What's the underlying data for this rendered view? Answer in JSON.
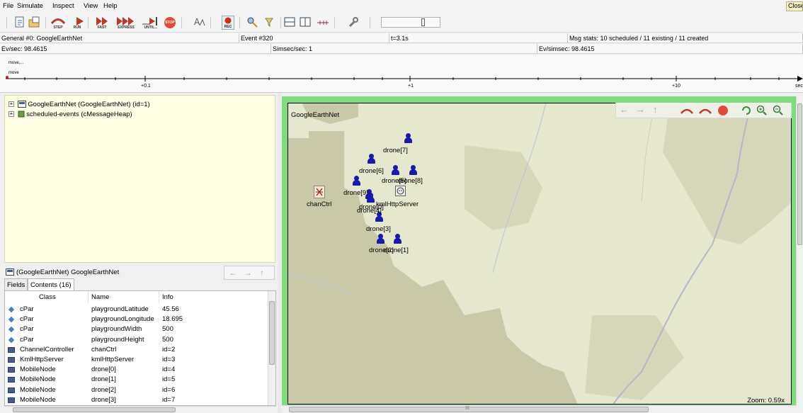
{
  "menu": {
    "items": [
      "File",
      "Simulate",
      "Inspect",
      "View",
      "Help"
    ],
    "close_label": "Close"
  },
  "toolbar": {
    "step_label": "STEP",
    "run_label": "RUN",
    "fast_label": "FAST",
    "express_label": "EXPRESS",
    "until_label": "UNTIL...",
    "stop_label": "STOP",
    "rec_label": "REC"
  },
  "status": {
    "network": "General #0: GoogleEarthNet",
    "event": "Event #320",
    "time": "t=3.1s",
    "msg_stats": "Msg stats: 10 scheduled / 11 existing / 11 created",
    "ev_sec": "Ev/sec: 98.4615",
    "simsec_sec": "Simsec/sec: 1",
    "ev_simsec": "Ev/simsec: 98.4615"
  },
  "timeline": {
    "msg1": "move,...",
    "msg2": "move",
    "ticks": [
      "+0.1",
      "+1",
      "+10",
      "sec"
    ]
  },
  "tree": {
    "items": [
      "GoogleEarthNet (GoogleEarthNet) (id=1)",
      "scheduled-events (cMessageHeap)"
    ]
  },
  "inspector": {
    "title": "(GoogleEarthNet) GoogleEarthNet",
    "tabs": [
      "Fields",
      "Contents (16)"
    ],
    "columns": [
      "Class",
      "Name",
      "Info"
    ],
    "rows": [
      {
        "icon": "param",
        "class": "cPar",
        "name": "playgroundLatitude",
        "info": "45.56"
      },
      {
        "icon": "param",
        "class": "cPar",
        "name": "playgroundLongitude",
        "info": "18.695"
      },
      {
        "icon": "param",
        "class": "cPar",
        "name": "playgroundWidth",
        "info": "500"
      },
      {
        "icon": "param",
        "class": "cPar",
        "name": "playgroundHeight",
        "info": "500"
      },
      {
        "icon": "module",
        "class": "ChannelController",
        "name": "chanCtrl",
        "info": "id=2"
      },
      {
        "icon": "module",
        "class": "KmlHttpServer",
        "name": "kmlHttpServer",
        "info": "id=3"
      },
      {
        "icon": "module",
        "class": "MobileNode",
        "name": "drone[0]",
        "info": "id=4"
      },
      {
        "icon": "module",
        "class": "MobileNode",
        "name": "drone[1]",
        "info": "id=5"
      },
      {
        "icon": "module",
        "class": "MobileNode",
        "name": "drone[2]",
        "info": "id=6"
      },
      {
        "icon": "module",
        "class": "MobileNode",
        "name": "drone[3]",
        "info": "id=7"
      }
    ]
  },
  "map": {
    "title": "GoogleEarthNet",
    "chan_ctrl_label": "chanCtrl",
    "kml_server_label": "kmlHttpServer",
    "drone_labels": [
      "drone[7]",
      "drone[6]",
      "drone[5]",
      "drone[8]",
      "drone[9]",
      "drone[0]",
      "drone[4]",
      "drone[3]",
      "drone[2]",
      "drone[1]"
    ],
    "zoom": "Zoom: 0.59x",
    "scroll_mark": "III"
  },
  "colors": {
    "map_frame": "#7edc7e",
    "drone": "#1a1aa8",
    "tree_bg": "#ffffe6",
    "stop": "#e04a3a"
  }
}
